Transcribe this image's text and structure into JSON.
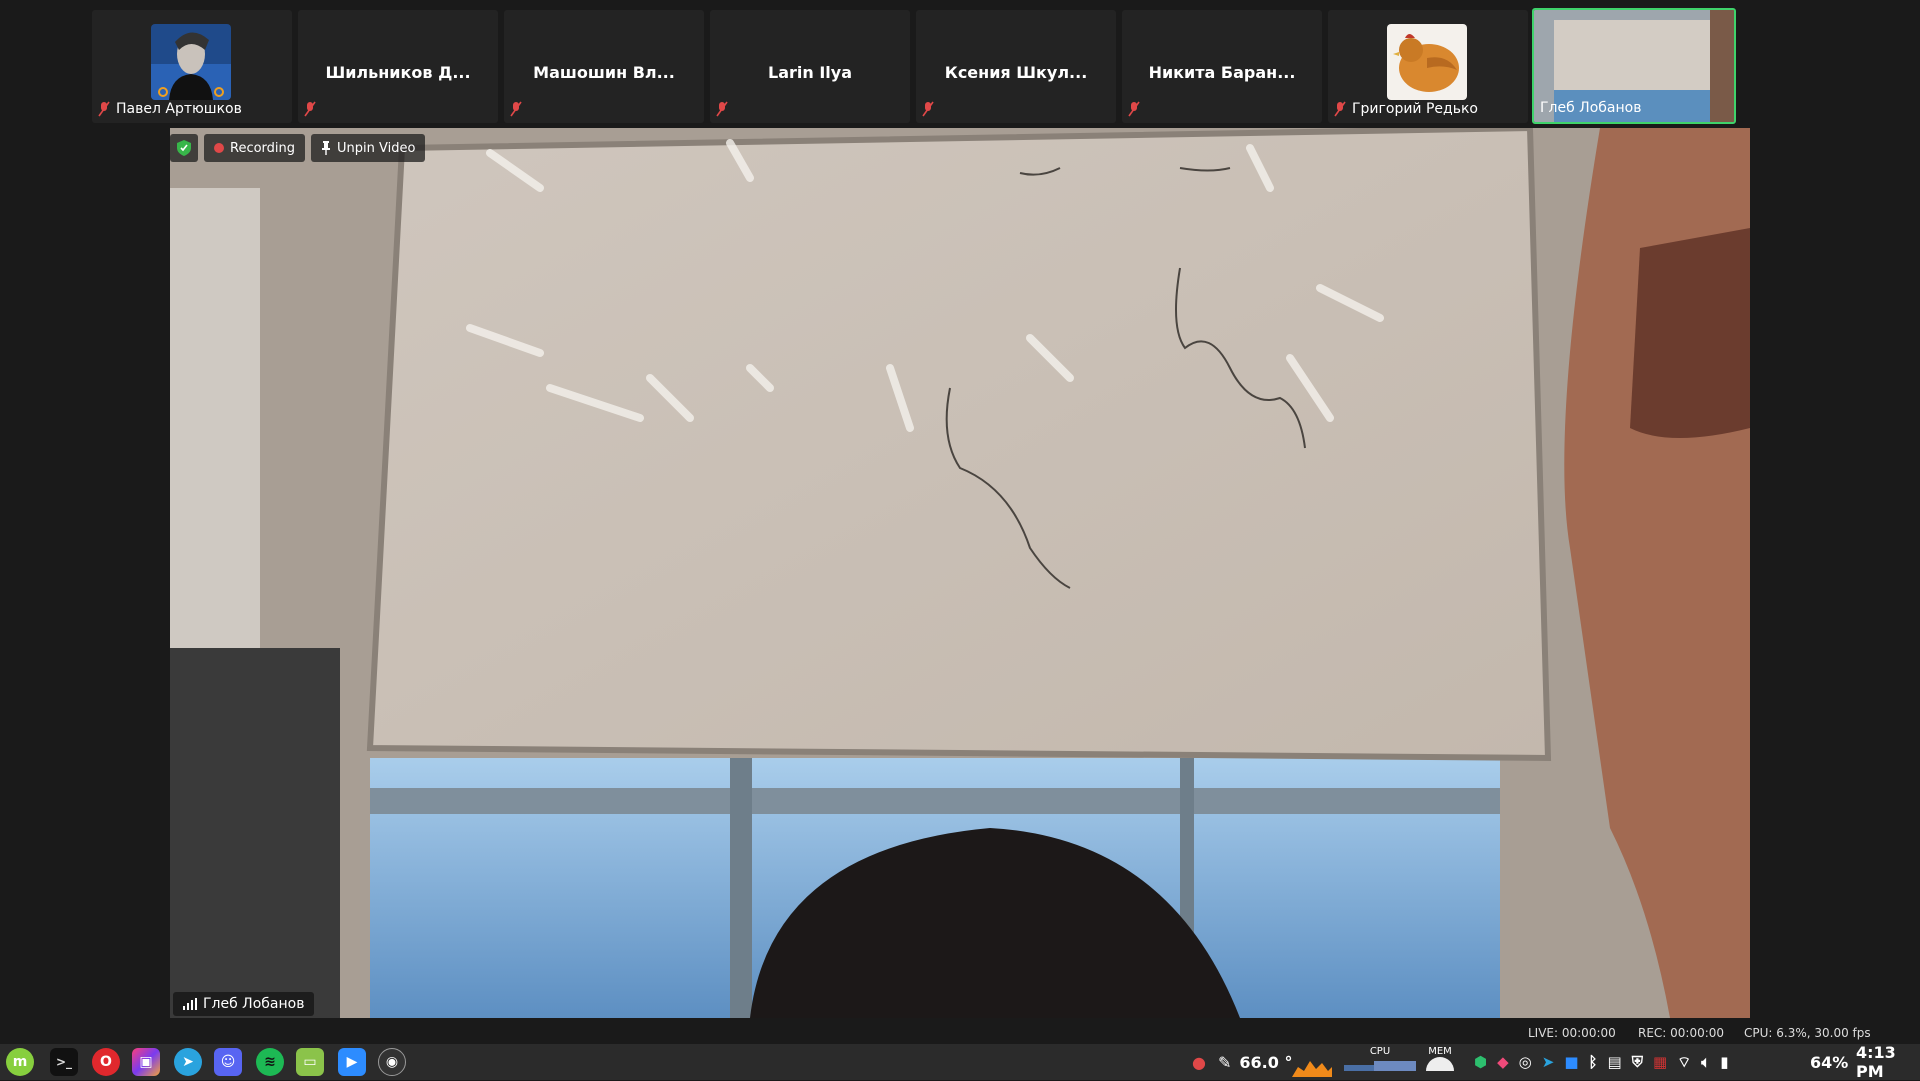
{
  "participants": [
    {
      "name": "Павел Артюшков",
      "muted": true,
      "avatar": "portrait-avatar"
    },
    {
      "name": "Шильников Д...",
      "muted": true
    },
    {
      "name": "Машошин Вл...",
      "muted": true
    },
    {
      "name": "Larin Ilya",
      "muted": true
    },
    {
      "name": "Ксения Шкул...",
      "muted": true
    },
    {
      "name": "Никита Баран...",
      "muted": true
    },
    {
      "name": "Григорий Редько",
      "muted": true,
      "avatar": "chicken-avatar"
    },
    {
      "name": "Глеб Лобанов",
      "muted": false,
      "active": true
    }
  ],
  "overlay": {
    "recording_label": "Recording",
    "unpin_label": "Unpin Video"
  },
  "speaker": {
    "name": "Глеб Лобанов"
  },
  "status": {
    "live": "LIVE: 00:00:00",
    "rec": "REC: 00:00:00",
    "cpu": "CPU: 6.3%, 30.00 fps"
  },
  "tray": {
    "temperature": "66.0 °",
    "cpu_label": "CPU",
    "mem_label": "MEM",
    "battery": "64%",
    "clock": "4:13 PM"
  },
  "colors": {
    "active_border": "#3fd36b",
    "recording_dot": "#e04848",
    "muted_icon": "#e04848"
  },
  "taskbar_apps": [
    "mint-menu-icon",
    "terminal-icon",
    "opera-icon",
    "jetbrains-toolbox-icon",
    "telegram-icon",
    "discord-icon",
    "spotify-icon",
    "files-icon",
    "zoom-icon",
    "obs-icon"
  ]
}
